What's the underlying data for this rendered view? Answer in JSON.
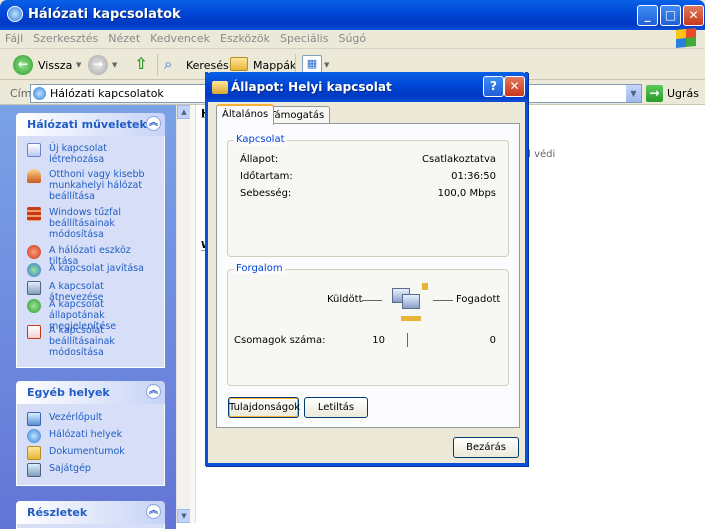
{
  "window": {
    "title": "Hálózati kapcsolatok"
  },
  "menu": [
    "Fájl",
    "Szerkesztés",
    "Nézet",
    "Kedvencek",
    "Eszközök",
    "Speciális",
    "Súgó"
  ],
  "toolbar": {
    "back": "Vissza",
    "search": "Keresés",
    "folders": "Mappák"
  },
  "address": {
    "label": "Cím",
    "value": "Hálózati kapcsolatok",
    "go": "Ugrás"
  },
  "left": {
    "network_tasks": {
      "title": "Hálózati műveletek",
      "items": [
        "Új kapcsolat létrehozása",
        "Otthoni vagy kisebb munkahelyi hálózat beállítása",
        "Windows tűzfal beállításainak módosítása",
        "A hálózati eszköz tiltása",
        "A kapcsolat javítása",
        "A kapcsolat átnevezése",
        "A kapcsolat állapotának megjelenítése",
        "A kapcsolat beállításainak módosítása"
      ]
    },
    "other_places": {
      "title": "Egyéb helyek",
      "items": [
        "Vezérlőpult",
        "Hálózati helyek",
        "Dokumentumok",
        "Sajátgép"
      ]
    },
    "details": {
      "title": "Részletek"
    }
  },
  "content": {
    "col_h": "H",
    "side_text_1": "al védi",
    "side_text_2": "r",
    "mark_w": "W"
  },
  "dialog": {
    "title": "Állapot: Helyi kapcsolat",
    "tabs": [
      "Általános",
      "Támogatás"
    ],
    "connection": {
      "title": "Kapcsolat",
      "status_label": "Állapot:",
      "status_value": "Csatlakoztatva",
      "duration_label": "Időtartam:",
      "duration_value": "01:36:50",
      "speed_label": "Sebesség:",
      "speed_value": "100,0 Mbps"
    },
    "traffic": {
      "title": "Forgalom",
      "sent_label": "Küldött",
      "received_label": "Fogadott",
      "packets_label": "Csomagok száma:",
      "packets_sent": "10",
      "packets_received": "0"
    },
    "buttons": {
      "properties": "Tulajdonságok",
      "disable": "Letiltás",
      "close": "Bezárás"
    }
  }
}
